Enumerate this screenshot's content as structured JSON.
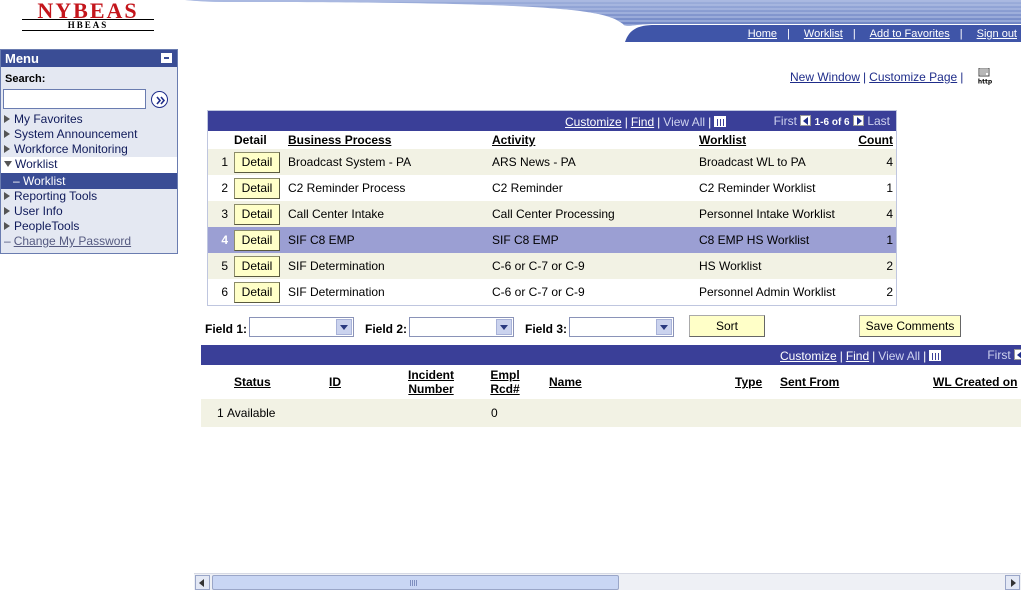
{
  "logo": {
    "brand": "NYBEAS",
    "sub": "HBEAS"
  },
  "header_links": [
    "Home",
    "Worklist",
    "Add to Favorites",
    "Sign out"
  ],
  "menu": {
    "title": "Menu",
    "search_label": "Search:",
    "items": [
      {
        "label": "My Favorites"
      },
      {
        "label": "System Announcement"
      },
      {
        "label": "Workforce Monitoring"
      },
      {
        "label": "Worklist"
      },
      {
        "label": "Worklist"
      },
      {
        "label": "Reporting Tools"
      },
      {
        "label": "User Info"
      },
      {
        "label": "PeopleTools"
      },
      {
        "label": "Change My Password"
      }
    ]
  },
  "page_links": {
    "new_window": "New Window",
    "customize_page": "Customize Page",
    "http_icon": "http"
  },
  "worklist_grid": {
    "customize": "Customize",
    "find": "Find",
    "view_all": "View All",
    "first": "First",
    "range": "1-6 of 6",
    "last": "Last",
    "columns": {
      "detail": "Detail",
      "business_process": "Business Process",
      "activity": "Activity",
      "worklist": "Worklist",
      "count": "Count"
    },
    "detail_label": "Detail",
    "rows": [
      {
        "num": "1",
        "business_process": "Broadcast System - PA",
        "activity": "ARS News - PA",
        "worklist": "Broadcast WL to PA",
        "count": "4"
      },
      {
        "num": "2",
        "business_process": "C2 Reminder Process",
        "activity": "C2 Reminder",
        "worklist": "C2 Reminder Worklist",
        "count": "1"
      },
      {
        "num": "3",
        "business_process": "Call Center Intake",
        "activity": "Call Center Processing",
        "worklist": "Personnel Intake Worklist",
        "count": "4"
      },
      {
        "num": "4",
        "business_process": "SIF C8 EMP",
        "activity": "SIF C8 EMP",
        "worklist": "C8 EMP HS Worklist",
        "count": "1"
      },
      {
        "num": "5",
        "business_process": "SIF Determination",
        "activity": "C-6 or C-7 or C-9",
        "worklist": "HS Worklist",
        "count": "2"
      },
      {
        "num": "6",
        "business_process": "SIF Determination",
        "activity": "C-6 or C-7 or C-9",
        "worklist": "Personnel Admin Worklist",
        "count": "2"
      }
    ]
  },
  "sort_controls": {
    "field1": "Field 1:",
    "field2": "Field 2:",
    "field3": "Field 3:",
    "field1_value": "",
    "field2_value": "",
    "field3_value": "",
    "sort": "Sort",
    "save_comments": "Save Comments"
  },
  "detail_grid": {
    "customize": "Customize",
    "find": "Find",
    "view_all": "View All",
    "first": "First",
    "columns": {
      "status": "Status",
      "id": "ID",
      "incident_number_1": "Incident",
      "incident_number_2": "Number",
      "empl_rcd_1": "Empl",
      "empl_rcd_2": "Rcd#",
      "name": "Name",
      "type": "Type",
      "sent_from": "Sent From",
      "wl_created_on": "WL Created on"
    },
    "row": {
      "num": "1",
      "status": "Available",
      "empl_rcd": "0"
    }
  }
}
